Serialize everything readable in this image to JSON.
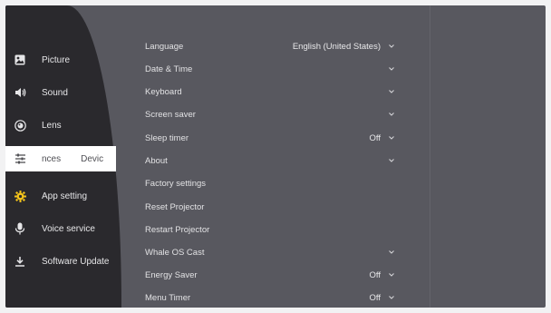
{
  "sidebar": {
    "items": [
      {
        "label": "Picture",
        "icon": "picture-icon"
      },
      {
        "label": "Sound",
        "icon": "speaker-icon"
      },
      {
        "label": "Lens",
        "icon": "lens-icon"
      },
      {
        "label": "nces",
        "label2": "Devic",
        "icon": "sliders-icon",
        "active": true
      },
      {
        "label": "App setting",
        "icon": "gear-icon"
      },
      {
        "label": "Voice service",
        "icon": "microphone-icon"
      },
      {
        "label": "Software Update",
        "icon": "download-icon"
      }
    ]
  },
  "settings": [
    {
      "label": "Language",
      "value": "English (United States)",
      "dropdown": true
    },
    {
      "label": "Date & Time",
      "value": "",
      "dropdown": true
    },
    {
      "label": "Keyboard",
      "value": "",
      "dropdown": true
    },
    {
      "label": "Screen saver",
      "value": "",
      "dropdown": true
    },
    {
      "label": "Sleep timer",
      "value": "Off",
      "dropdown": true
    },
    {
      "label": "About",
      "value": "",
      "dropdown": true
    },
    {
      "label": "Factory settings",
      "value": "",
      "dropdown": false
    },
    {
      "label": "Reset Projector",
      "value": "",
      "dropdown": false
    },
    {
      "label": "Restart Projector",
      "value": "",
      "dropdown": false
    },
    {
      "label": "Whale OS Cast",
      "value": "",
      "dropdown": true
    },
    {
      "label": "Energy Saver",
      "value": "Off",
      "dropdown": true
    },
    {
      "label": "Menu Timer",
      "value": "Off",
      "dropdown": true
    }
  ],
  "colors": {
    "background": "#58585f",
    "nav_background": "#2a292d",
    "active_item": "#ffffff",
    "icon_accent": "#f2c21b"
  }
}
